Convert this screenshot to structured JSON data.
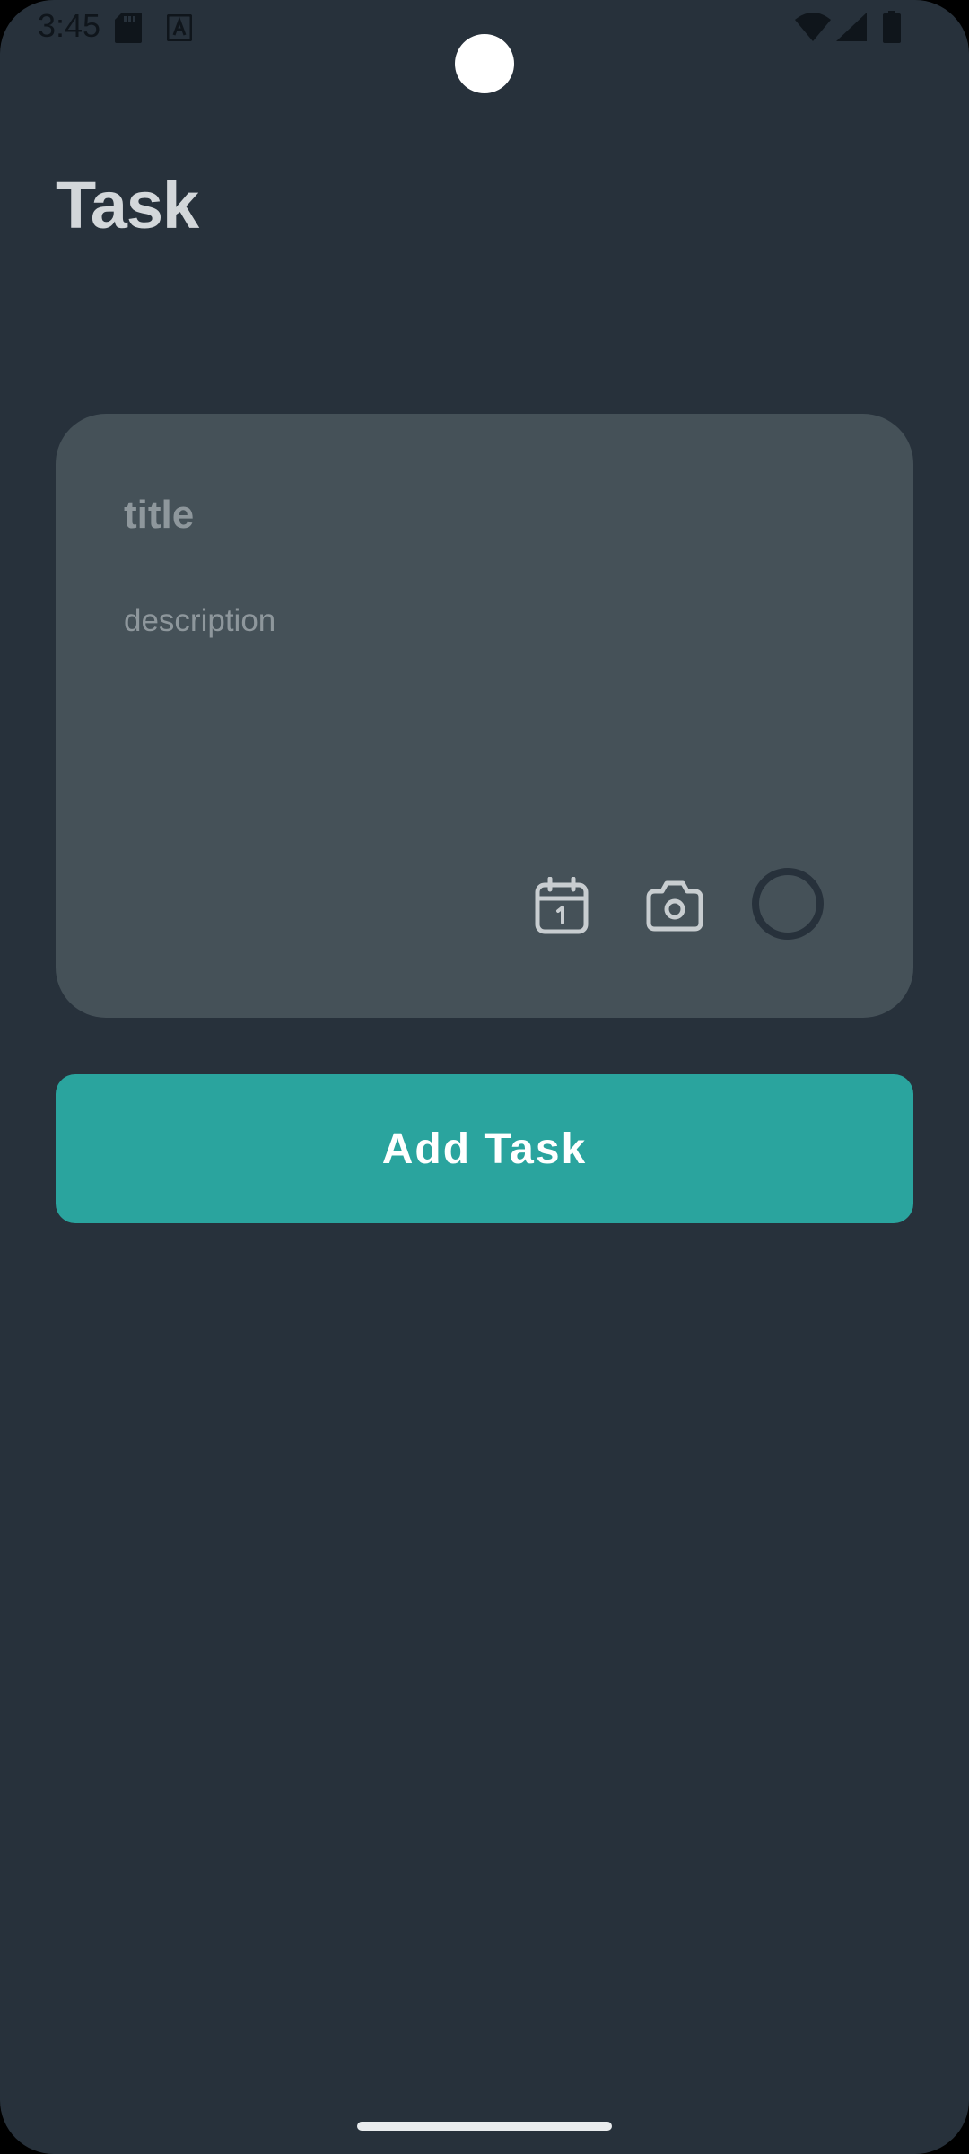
{
  "status_bar": {
    "time": "3:45",
    "icons": [
      "sd-card-icon",
      "a-notification-icon",
      "wifi-icon",
      "signal-icon",
      "battery-icon"
    ]
  },
  "page": {
    "title": "Task"
  },
  "task_card": {
    "title_placeholder": "title",
    "title_value": "",
    "description_placeholder": "description",
    "description_value": "",
    "icons": [
      "calendar-icon",
      "camera-icon",
      "status-circle-icon"
    ]
  },
  "actions": {
    "add_task_label": "Add Task"
  },
  "colors": {
    "background": "#27313b",
    "card": "#455158",
    "accent": "#2aa49e",
    "title_text": "#d3d7da",
    "placeholder_text": "#8e979c"
  }
}
